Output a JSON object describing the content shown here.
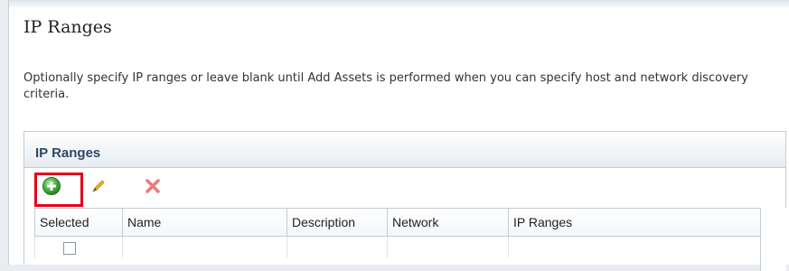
{
  "page": {
    "title": "IP Ranges",
    "description": "Optionally specify IP ranges or leave blank until Add Assets is performed when you can specify host and network discovery criteria."
  },
  "region": {
    "title": "IP Ranges"
  },
  "toolbar": {
    "buttons": [
      {
        "icon": "add-circle-icon",
        "color": "#3a9a35",
        "highlighted": true
      },
      {
        "icon": "pencil-icon",
        "color": "#e0a020"
      },
      {
        "icon": "delete-x-icon",
        "color": "#e86a6a"
      }
    ],
    "highlight_color": "#e3001b"
  },
  "table": {
    "columns": [
      "Selected",
      "Name",
      "Description",
      "Network",
      "IP Ranges"
    ],
    "rows": [
      {
        "selected": false
      }
    ]
  },
  "colors": {
    "region_title": "#2f4864",
    "border": "#c4ccd6"
  }
}
